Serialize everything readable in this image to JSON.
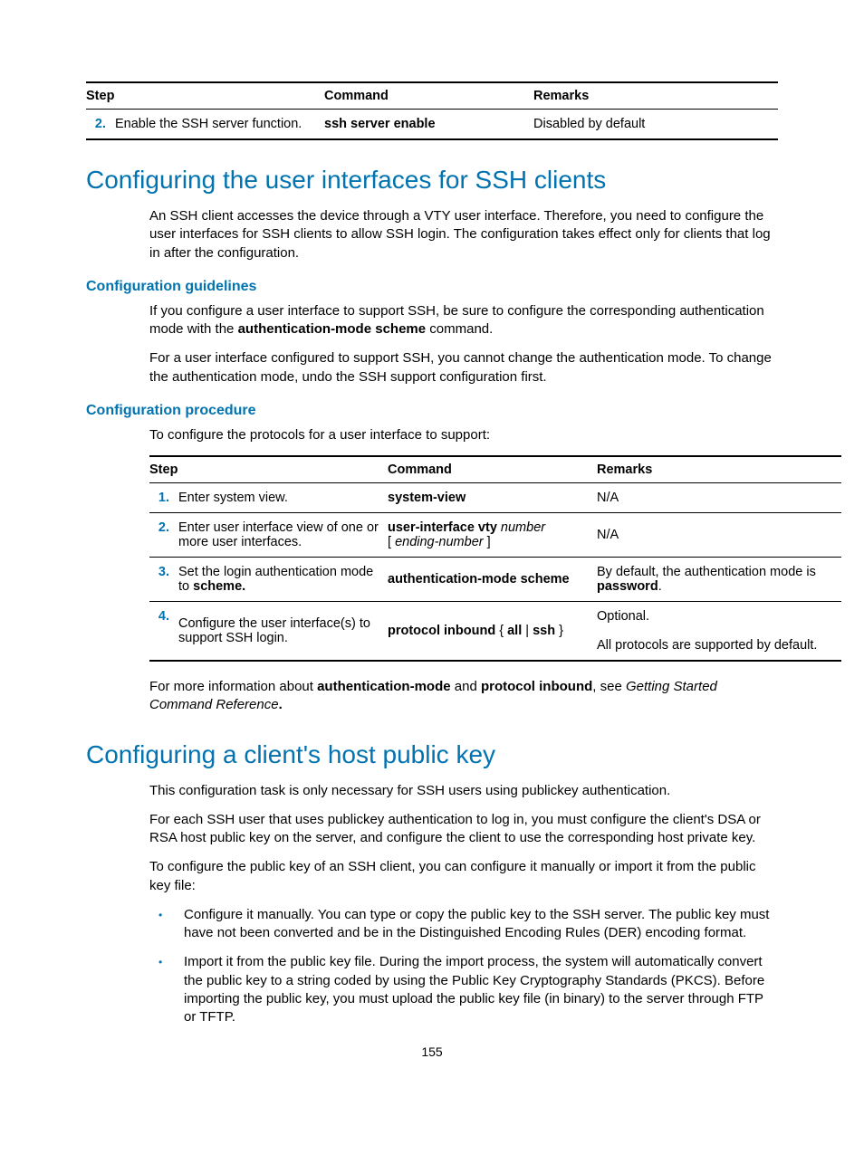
{
  "table1": {
    "headers": {
      "step": "Step",
      "command": "Command",
      "remarks": "Remarks"
    },
    "rows": [
      {
        "num": "2.",
        "desc": "Enable the SSH server function.",
        "cmd": "ssh server enable",
        "rmk": "Disabled by default"
      }
    ]
  },
  "s1": {
    "title": "Configuring the user interfaces for SSH clients",
    "intro": "An SSH client accesses the device through a VTY user interface. Therefore, you need to configure the user interfaces for SSH clients to allow SSH login. The configuration takes effect only for clients that log in after the configuration.",
    "guidelines_title": "Configuration guidelines",
    "g1a": "If you configure a user interface to support SSH, be sure to configure the corresponding authentication mode with the ",
    "g1b": "authentication-mode scheme",
    "g1c": " command.",
    "g2": "For a user interface configured to support SSH, you cannot change the authentication mode. To change the authentication mode, undo the SSH support configuration first.",
    "procedure_title": "Configuration procedure",
    "proc_intro": "To configure the protocols for a user interface to support:"
  },
  "table2": {
    "headers": {
      "step": "Step",
      "command": "Command",
      "remarks": "Remarks"
    },
    "rows": [
      {
        "num": "1.",
        "desc": "Enter system view.",
        "cmd": "system-view",
        "rmk": "N/A"
      },
      {
        "num": "2.",
        "desc": "Enter user interface view of one or more user interfaces.",
        "cmd_b1": "user-interface vty",
        "cmd_i1": " number",
        "cmd_p2a": "[ ",
        "cmd_p2i": "ending-number",
        "cmd_p2b": " ]",
        "rmk": "N/A"
      },
      {
        "num": "3.",
        "desc_a": "Set the login authentication mode to ",
        "desc_b": "scheme.",
        "cmd": "authentication-mode scheme",
        "rmk_a": "By default, the authentication mode is ",
        "rmk_b": "password",
        "rmk_c": "."
      },
      {
        "num": "4.",
        "desc": "Configure the user interface(s) to support SSH login.",
        "cmd_b1": "protocol inbound",
        "cmd_p": " { ",
        "cmd_b2": "all",
        "cmd_p2": " | ",
        "cmd_b3": "ssh",
        "cmd_p3": " }",
        "rmk_a": "Optional.",
        "rmk_b": "All protocols are supported by default."
      }
    ]
  },
  "after_t2": {
    "a": "For more information about ",
    "b1": "authentication-mode",
    "c": " and ",
    "b2": "protocol inbound",
    "d": ", see ",
    "i": "Getting Started Command Reference",
    "e": "."
  },
  "s2": {
    "title": "Configuring a client's host public key",
    "p1": "This configuration task is only necessary for SSH users using publickey authentication.",
    "p2": "For each SSH user that uses publickey authentication to log in, you must configure the client's DSA or RSA host public key on the server, and configure the client to use the corresponding host private key.",
    "p3": "To configure the public key of an SSH client, you can configure it manually or import it from the public key file:",
    "b1": "Configure it manually. You can type or copy the public key to the SSH server. The public key must have not been converted and be in the Distinguished Encoding Rules (DER) encoding format.",
    "b2": "Import it from the public key file. During the import process, the system will automatically convert the public key to a string coded by using the Public Key Cryptography Standards (PKCS). Before importing the public key, you must upload the public key file (in binary) to the server through FTP or TFTP."
  },
  "pagenum": "155"
}
